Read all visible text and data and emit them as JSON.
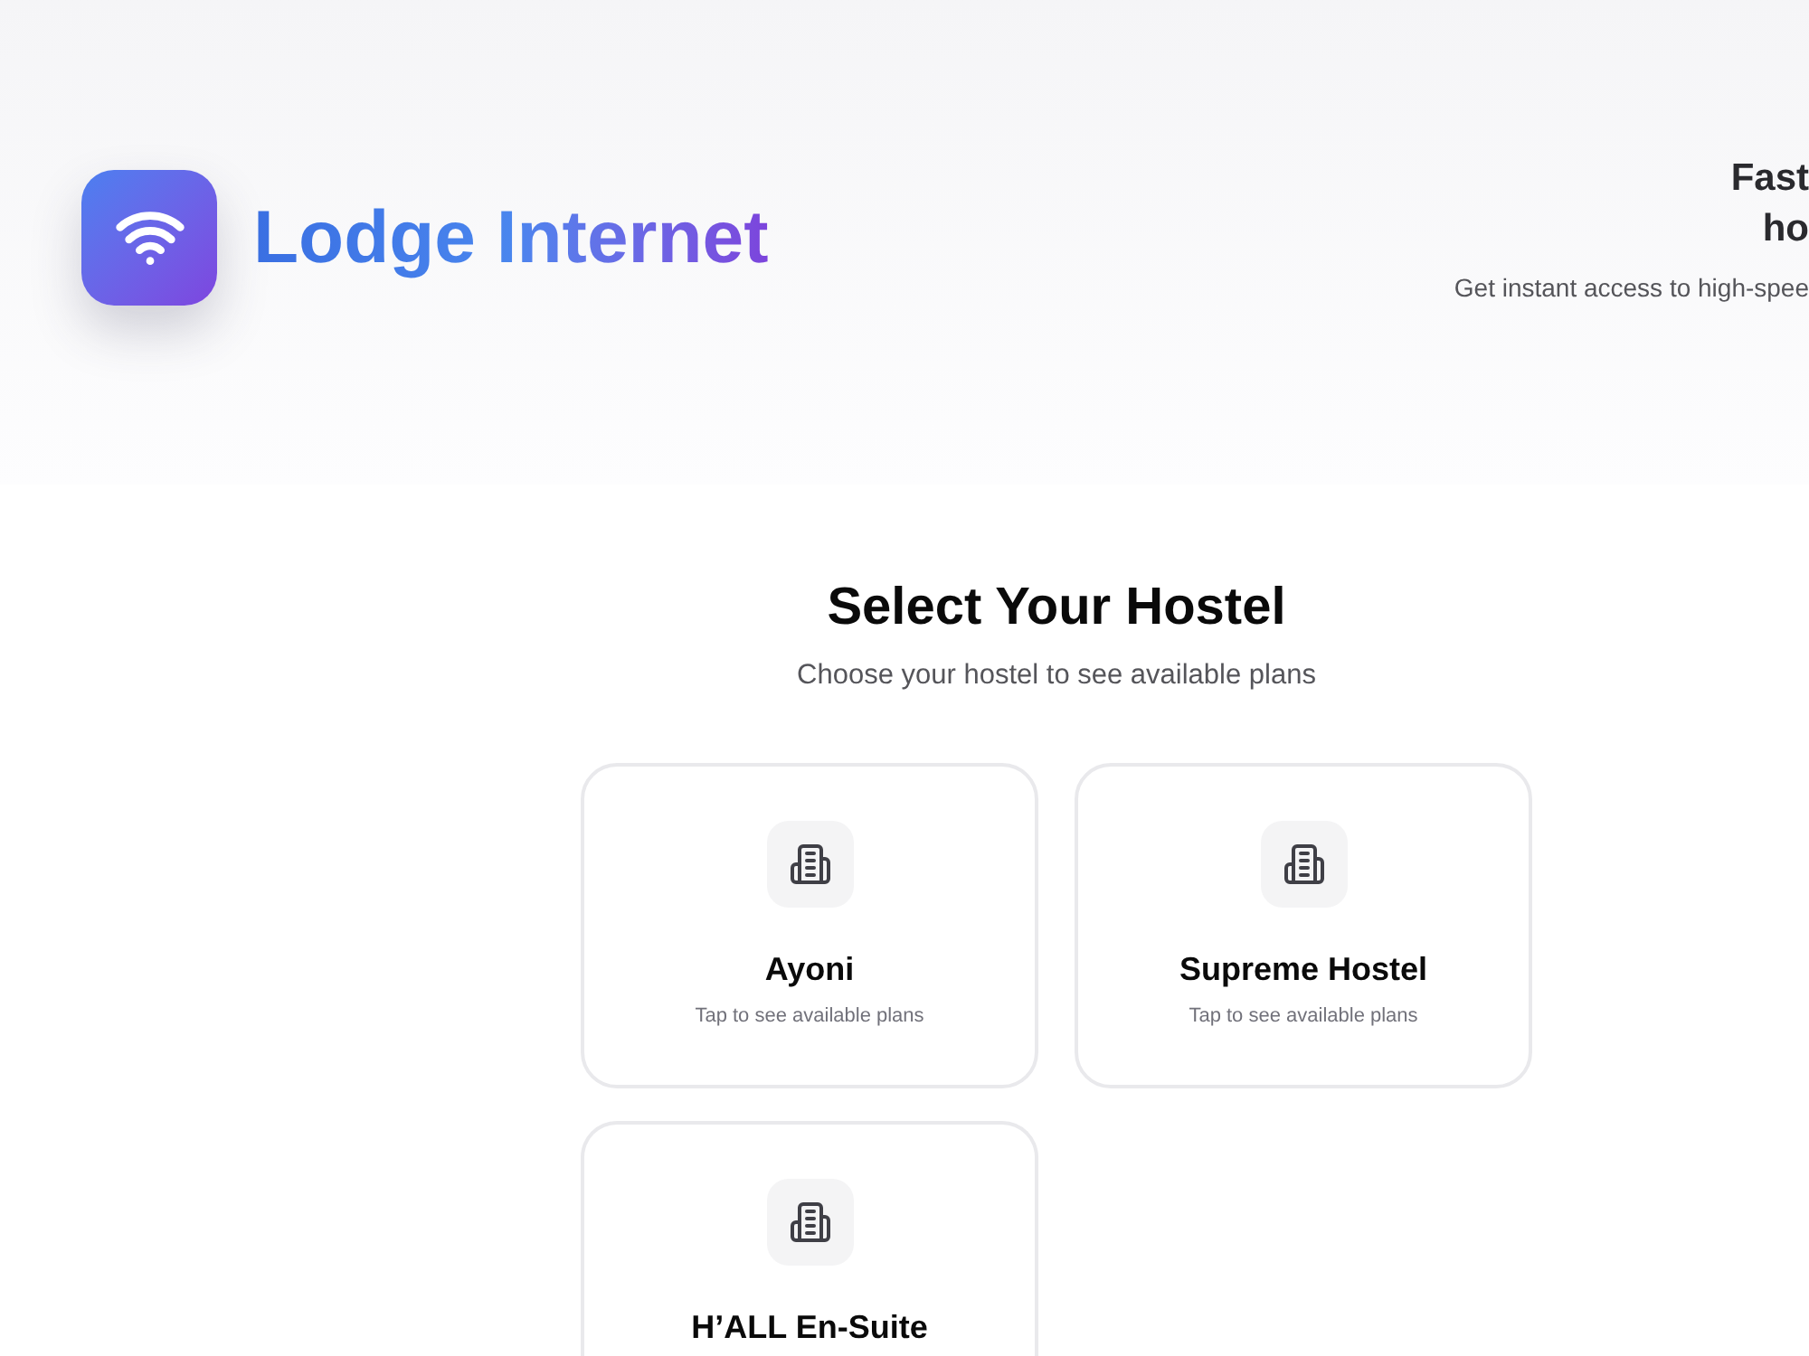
{
  "brand": {
    "name": "Lodge Internet"
  },
  "hero": {
    "title_lines": [
      "Fast",
      "ho"
    ],
    "subtitle": "Get instant access to high-spee"
  },
  "section": {
    "title": "Select Your Hostel",
    "subtitle": "Choose your hostel to see available plans"
  },
  "hostels": [
    {
      "name": "Ayoni",
      "hint": "Tap to see available plans"
    },
    {
      "name": "Supreme Hostel",
      "hint": "Tap to see available plans"
    },
    {
      "name": "H’ALL En-Suite"
    }
  ]
}
